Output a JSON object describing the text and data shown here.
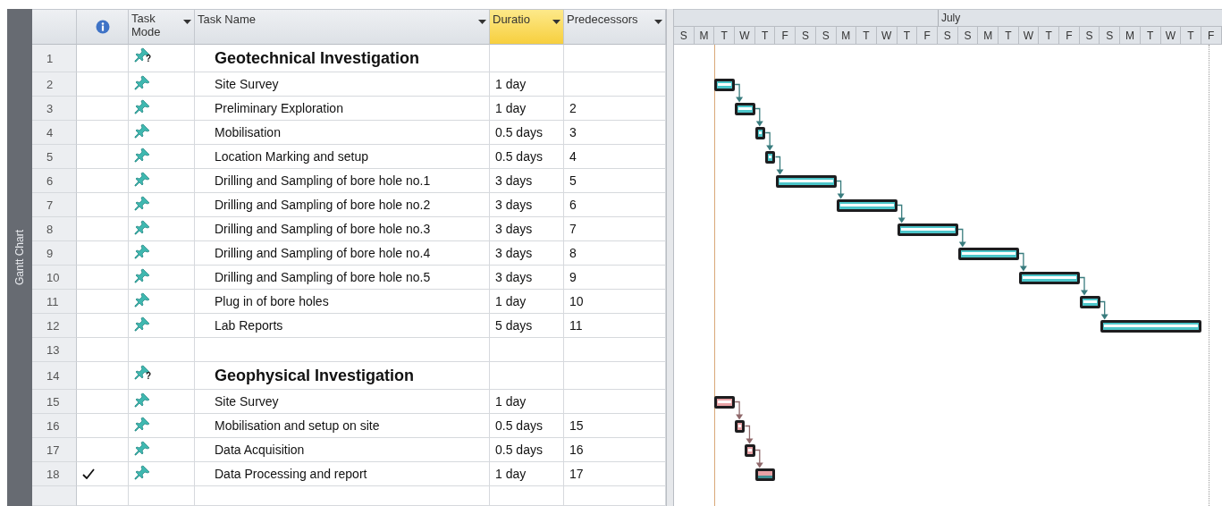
{
  "view_bar": {
    "label": "Gantt Chart"
  },
  "columns": [
    {
      "kind": "row_number"
    },
    {
      "kind": "indicators",
      "selected": false
    },
    {
      "kind": "mode",
      "label": "Task Mode",
      "menu": true,
      "selected": false
    },
    {
      "kind": "name",
      "label": "Task Name",
      "menu": true,
      "selected": false
    },
    {
      "kind": "duration",
      "label": "Duratio",
      "menu": true,
      "selected": true
    },
    {
      "kind": "predecessors",
      "label": "Predecessors",
      "menu": true,
      "selected": false
    }
  ],
  "timescale": {
    "lead_days": [
      {
        "label": "S",
        "project_start": false
      },
      {
        "label": "M",
        "project_start": false
      },
      {
        "label": "T",
        "project_start": true
      },
      {
        "label": "W",
        "project_start": false
      },
      {
        "label": "T",
        "project_start": false
      },
      {
        "label": "F",
        "project_start": false
      },
      {
        "label": "S",
        "project_start": false
      },
      {
        "label": "S",
        "project_start": false
      },
      {
        "label": "M",
        "project_start": false
      },
      {
        "label": "T",
        "project_start": false
      },
      {
        "label": "W",
        "project_start": false
      },
      {
        "label": "T",
        "project_start": false
      },
      {
        "label": "F",
        "project_start": false
      }
    ],
    "months": [
      {
        "label": "July",
        "days": [
          {
            "label": "S",
            "project_start": false
          },
          {
            "label": "S",
            "project_start": false
          },
          {
            "label": "M",
            "project_start": false
          },
          {
            "label": "T",
            "project_start": false
          },
          {
            "label": "W",
            "project_start": false
          },
          {
            "label": "T",
            "project_start": false
          },
          {
            "label": "F",
            "project_start": false
          },
          {
            "label": "S",
            "project_start": false
          },
          {
            "label": "S",
            "project_start": false
          },
          {
            "label": "M",
            "project_start": false
          },
          {
            "label": "T",
            "project_start": false
          },
          {
            "label": "W",
            "project_start": false
          },
          {
            "label": "T",
            "project_start": false
          },
          {
            "label": "F",
            "project_start": false
          }
        ]
      }
    ]
  },
  "rows": [
    {
      "id": "1",
      "kind": "summary",
      "mode_badge": "?",
      "name": "Geotechnical Investigation"
    },
    {
      "id": "2",
      "kind": "task",
      "name": "Site Survey",
      "duration": "1 day",
      "color": "#4cc6ca",
      "completed": false
    },
    {
      "id": "3",
      "kind": "task",
      "name": "Preliminary Exploration",
      "duration": "1 day",
      "predecessors": "2",
      "color": "#4cc6ca",
      "completed": false
    },
    {
      "id": "4",
      "kind": "task",
      "name": "Mobilisation",
      "duration": "0.5 days",
      "predecessors": "3",
      "color": "#4cc6ca",
      "completed": false
    },
    {
      "id": "5",
      "kind": "task",
      "name": "Location Marking and setup",
      "duration": "0.5 days",
      "predecessors": "4",
      "color": "#4cc6ca",
      "completed": false
    },
    {
      "id": "6",
      "kind": "task",
      "name": "Drilling and Sampling of bore hole no.1",
      "duration": "3 days",
      "predecessors": "5",
      "color": "#4cc6ca",
      "completed": false
    },
    {
      "id": "7",
      "kind": "task",
      "name": "Drilling and Sampling of bore hole no.2",
      "duration": "3 days",
      "predecessors": "6",
      "color": "#4cc6ca",
      "completed": false
    },
    {
      "id": "8",
      "kind": "task",
      "name": "Drilling and Sampling of bore hole no.3",
      "duration": "3 days",
      "predecessors": "7",
      "color": "#4cc6ca",
      "completed": false
    },
    {
      "id": "9",
      "kind": "task",
      "name": "Drilling and Sampling of bore hole no.4",
      "duration": "3 days",
      "predecessors": "8",
      "color": "#4cc6ca",
      "completed": false
    },
    {
      "id": "10",
      "kind": "task",
      "name": "Drilling and Sampling of bore hole no.5",
      "duration": "3 days",
      "predecessors": "9",
      "color": "#4cc6ca",
      "completed": false
    },
    {
      "id": "11",
      "kind": "task",
      "name": "Plug in of bore holes",
      "duration": "1 day",
      "predecessors": "10",
      "color": "#4cc6ca",
      "completed": false
    },
    {
      "id": "12",
      "kind": "task",
      "name": "Lab Reports",
      "duration": "5 days",
      "predecessors": "11",
      "color": "#4cc6ca",
      "completed": false
    },
    {
      "id": "13",
      "kind": "blank"
    },
    {
      "id": "14",
      "kind": "summary",
      "mode_badge": "?",
      "name": "Geophysical Investigation"
    },
    {
      "id": "15",
      "kind": "task",
      "name": "Site Survey",
      "duration": "1 day",
      "color": "#e8a2a6",
      "completed": false
    },
    {
      "id": "16",
      "kind": "task",
      "name": "Mobilisation and setup on site",
      "duration": "0.5 days",
      "predecessors": "15",
      "color": "#e8a2a6",
      "completed": false
    },
    {
      "id": "17",
      "kind": "task",
      "name": "Data Acquisition",
      "duration": "0.5 days",
      "predecessors": "16",
      "color": "#e8a2a6",
      "completed": false
    },
    {
      "id": "18",
      "kind": "task",
      "name": "Data Processing and report",
      "duration": "1 day",
      "predecessors": "17",
      "color": "#e8a2a6",
      "completed": true
    }
  ]
}
